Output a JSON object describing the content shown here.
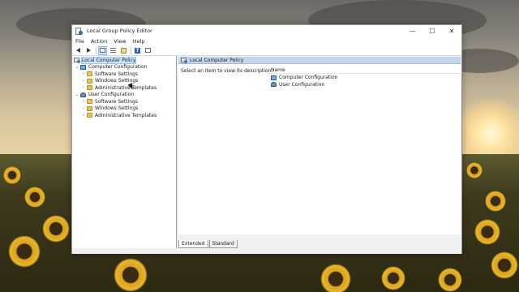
{
  "window": {
    "title": "Local Group Policy Editor",
    "controls": {
      "minimize": "—",
      "maximize": "☐",
      "close": "✕"
    }
  },
  "menu": [
    "File",
    "Action",
    "View",
    "Help"
  ],
  "toolbar": [
    "back-arrow-icon",
    "forward-arrow-icon",
    "console-tree-icon",
    "properties-icon",
    "export-list-icon",
    "help-icon",
    "filter-icon"
  ],
  "tree": {
    "root": "Local Computer Policy",
    "computer": {
      "label": "Computer Configuration",
      "children": [
        "Software Settings",
        "Windows Settings",
        "Administrative Templates"
      ]
    },
    "user": {
      "label": "User Configuration",
      "children": [
        "Software Settings",
        "Windows Settings",
        "Administrative Templates"
      ]
    }
  },
  "details": {
    "header": "Local Computer Policy",
    "description": "Select an item to view its description.",
    "column_name": "Name",
    "items": [
      "Computer Configuration",
      "User Configuration"
    ]
  },
  "tabs": {
    "extended": "Extended",
    "standard": "Standard"
  },
  "colors": {
    "selection": "#cce4f7",
    "header": "#c5d6ec",
    "folder": "#e8c15a"
  }
}
